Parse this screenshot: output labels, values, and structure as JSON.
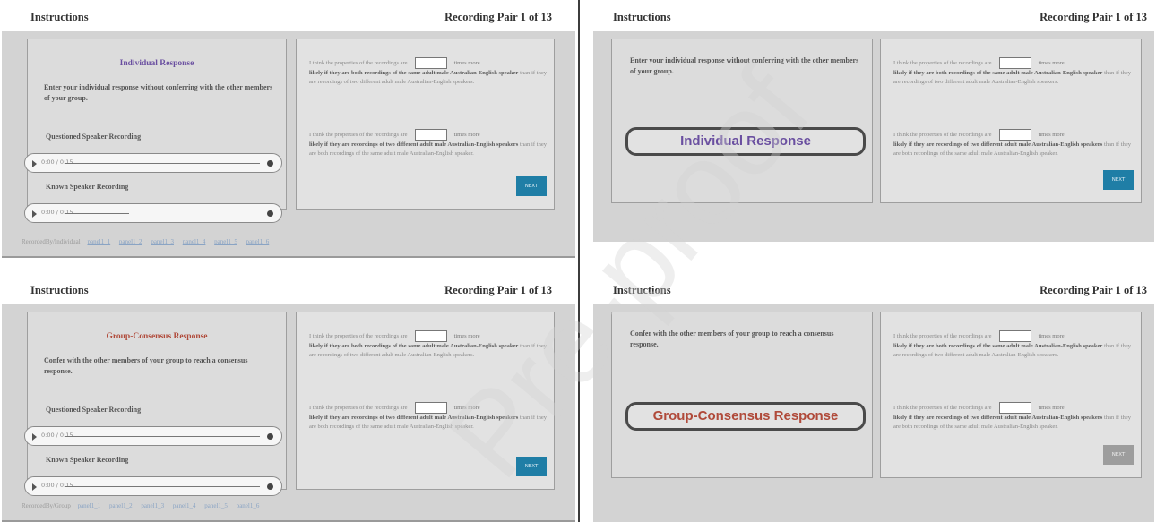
{
  "header": {
    "instructions": "Instructions",
    "pair_label": "Recording Pair 1 of 13"
  },
  "individual": {
    "title": "Individual Response",
    "instructions": "Enter your individual response without conferring with the other members of your group."
  },
  "group": {
    "title": "Group-Consensus Response",
    "instructions": "Confer with the other members of your group to reach a consensus response."
  },
  "recordings": {
    "questioned": "Questioned Speaker Recording",
    "known": "Known Speaker Recording",
    "time": "0:00 / 0:15"
  },
  "question1": {
    "prefix": "I think the properties of the recordings are",
    "suffix": "times more",
    "bold": "likely if they are both recordings of the same adult male Australian-English speaker",
    "rest": "than if they are recordings of two different adult male Australian-English speakers."
  },
  "question2": {
    "prefix": "I think the properties of the recordings are",
    "suffix": "times more",
    "bold": "likely if they are recordings of two different adult male Australian-English speakers",
    "rest": "than if they are both recordings of the same adult male Australian-English speaker."
  },
  "next_label": "NEXT",
  "user_row": {
    "label_tl": "RecordedBy/Individual",
    "label_bl": "RecordedBy/Group",
    "users": [
      "panel1_1",
      "panel1_2",
      "panel1_3",
      "panel1_4",
      "panel1_5",
      "panel1_6"
    ]
  },
  "watermark": "Pre-proof"
}
